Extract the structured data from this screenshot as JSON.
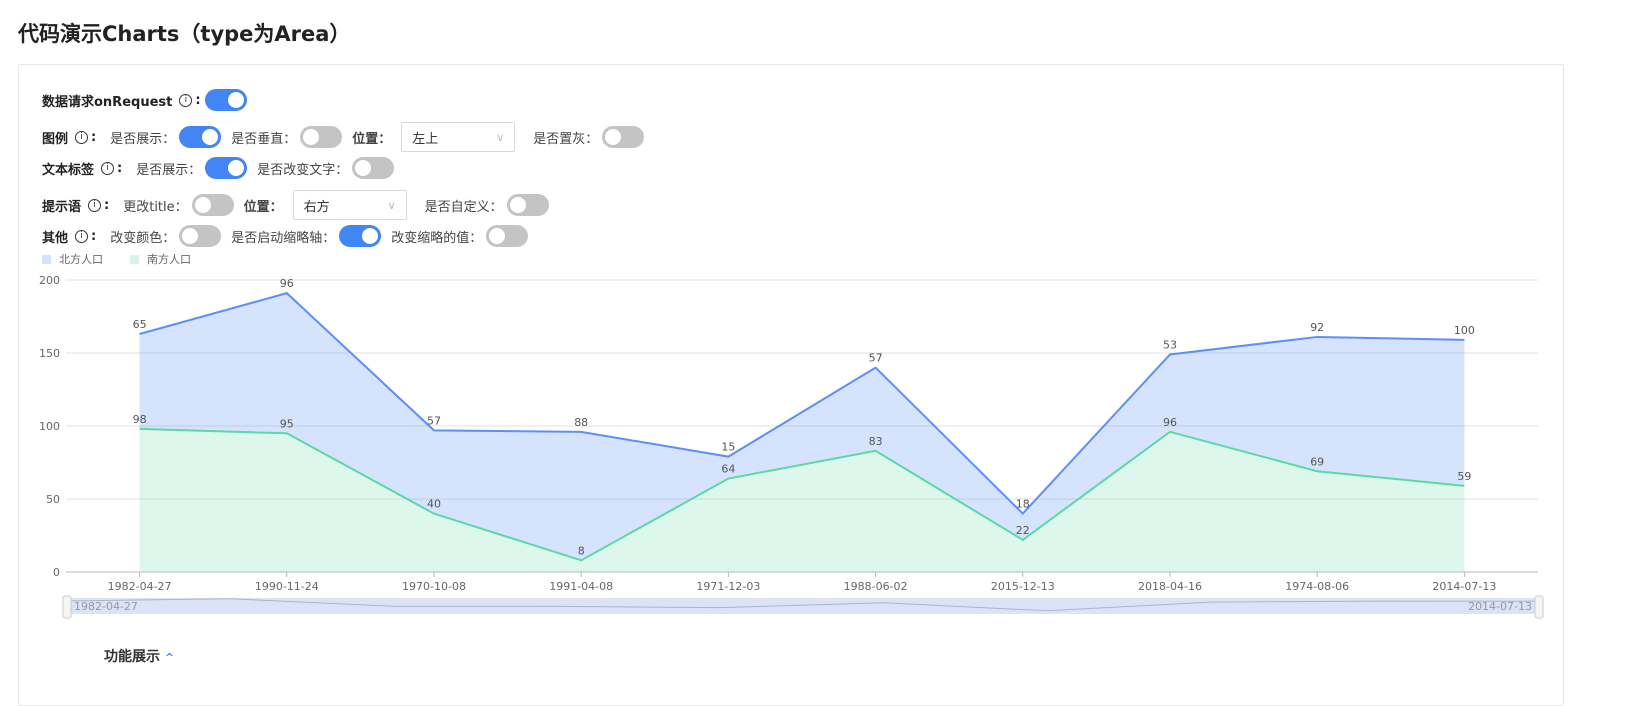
{
  "title": "代码演示Charts（type为Area）",
  "controls": {
    "request": {
      "label": "数据请求onRequest",
      "on": true
    },
    "legend": {
      "label": "图例",
      "show": "是否展示：",
      "vertical": "是否垂直：",
      "position": "位置：",
      "position_value": "左上",
      "gray": "是否置灰："
    },
    "text": {
      "label": "文本标签",
      "show": "是否展示：",
      "change": "是否改变文字："
    },
    "tooltip": {
      "label": "提示语",
      "title": "更改title：",
      "position": "位置：",
      "position_value": "右方",
      "custom": "是否自定义："
    },
    "other": {
      "label": "其他",
      "color": "改变颜色：",
      "zoom": "是否启动缩略轴：",
      "zoomval": "改变缩略的值："
    }
  },
  "footer": "功能展示",
  "chart_data": {
    "type": "area",
    "stacked": true,
    "categories": [
      "1982-04-27",
      "1990-11-24",
      "1970-10-08",
      "1991-04-08",
      "1971-12-03",
      "1988-06-02",
      "2015-12-13",
      "2018-04-16",
      "1974-08-06",
      "2014-07-13"
    ],
    "series": [
      {
        "name": "北方人口",
        "values": [
          65,
          96,
          57,
          88,
          15,
          57,
          18,
          53,
          92,
          100
        ],
        "color": "#5b8ff9"
      },
      {
        "name": "南方人口",
        "values": [
          98,
          95,
          40,
          8,
          64,
          83,
          22,
          96,
          69,
          59
        ],
        "color": "#5ad8a6"
      }
    ],
    "ylim": [
      0,
      200
    ],
    "yticks": [
      0,
      50,
      100,
      150,
      200
    ],
    "grid": true,
    "legend": "top-left",
    "slider": {
      "start": "1982-04-27",
      "end": "2014-07-13"
    }
  }
}
